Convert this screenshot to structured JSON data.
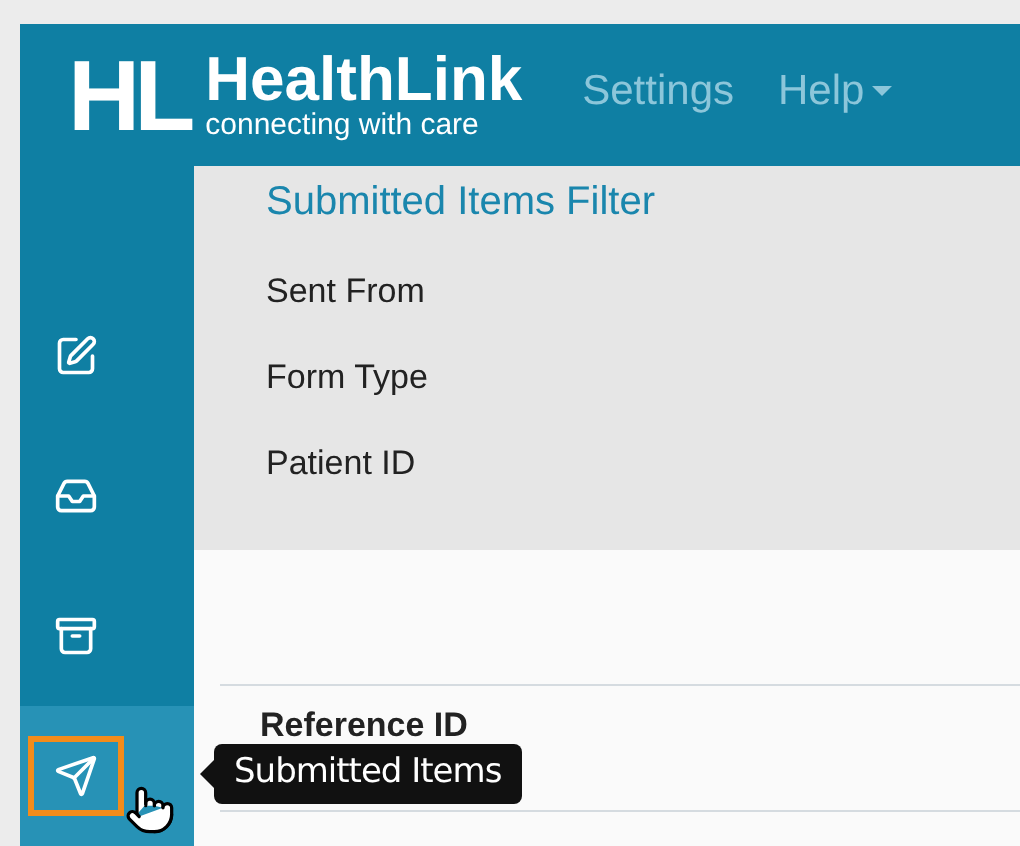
{
  "header": {
    "logo_mark": "HL",
    "brand": "HealthLink",
    "tagline": "connecting with care",
    "menu": [
      {
        "label": "Settings",
        "dropdown": false
      },
      {
        "label": "Help",
        "dropdown": true
      }
    ]
  },
  "sidebar": {
    "items": [
      {
        "kind": "edit",
        "selected": false
      },
      {
        "kind": "inbox",
        "selected": false
      },
      {
        "kind": "archive",
        "selected": false
      },
      {
        "kind": "send",
        "selected": true
      }
    ]
  },
  "filter": {
    "title": "Submitted Items Filter",
    "fields": [
      "Sent From",
      "Form Type",
      "Patient ID"
    ]
  },
  "table": {
    "columns": [
      "Reference ID"
    ]
  },
  "tooltip": {
    "text": "Submitted Items"
  }
}
